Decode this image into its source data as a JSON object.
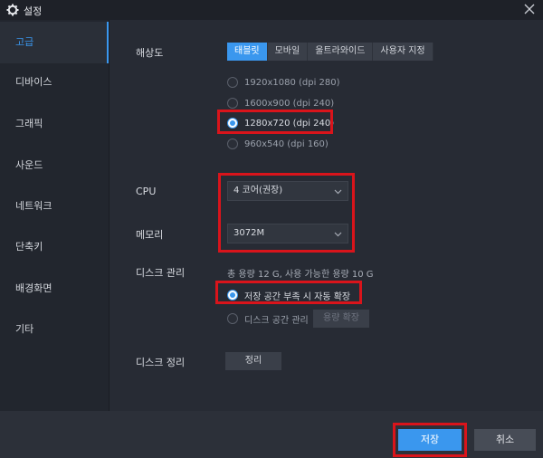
{
  "window": {
    "title": "설정"
  },
  "sidebar": {
    "items": [
      {
        "label": "고급",
        "active": true
      },
      {
        "label": "디바이스"
      },
      {
        "label": "그래픽"
      },
      {
        "label": "사운드"
      },
      {
        "label": "네트워크"
      },
      {
        "label": "단축키"
      },
      {
        "label": "배경화면"
      },
      {
        "label": "기타"
      }
    ]
  },
  "resolution": {
    "label": "해상도",
    "tabs": [
      "태블릿",
      "모바일",
      "울트라와이드",
      "사용자 지정"
    ],
    "active_tab": "태블릿",
    "options": [
      "1920x1080 (dpi 280)",
      "1600x900 (dpi 240)",
      "1280x720 (dpi 240)",
      "960x540 (dpi 160)"
    ],
    "selected": "1280x720 (dpi 240)"
  },
  "cpu": {
    "label": "CPU",
    "value": "4 코어(권장)"
  },
  "memory": {
    "label": "메모리",
    "value": "3072M"
  },
  "disk": {
    "label": "디스크 관리",
    "info": "총 용량 12 G,  사용 가능한 용량 10 G",
    "options": [
      "저장 공간 부족 시 자동 확장",
      "디스크 공간 관리"
    ],
    "selected": "저장 공간 부족 시 자동 확장",
    "expand_button": "용량 확장"
  },
  "cleanup": {
    "label": "디스크 정리",
    "button": "정리"
  },
  "footer": {
    "save": "저장",
    "cancel": "취소"
  },
  "colors": {
    "accent": "#3a97ee",
    "highlight": "#d9141b",
    "background": "#272b34"
  }
}
